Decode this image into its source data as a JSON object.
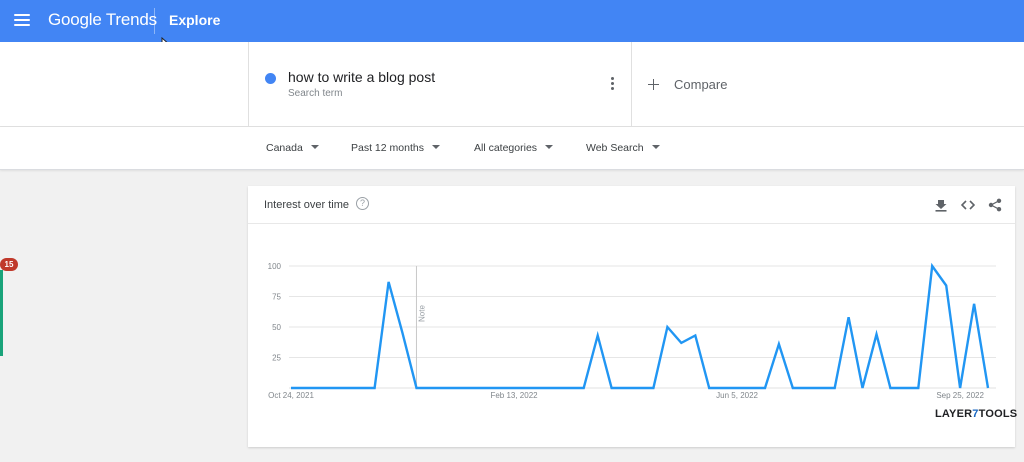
{
  "header": {
    "logo_text": "Google Trends",
    "section_title": "Explore",
    "menu_icon": "hamburger-menu-icon"
  },
  "search_terms": [
    {
      "label": "how to write a blog post",
      "sublabel": "Search term",
      "color": "#4285f4"
    }
  ],
  "compare": {
    "label": "Compare"
  },
  "filters": [
    {
      "label": "Canada"
    },
    {
      "label": "Past 12 months"
    },
    {
      "label": "All categories"
    },
    {
      "label": "Web Search"
    }
  ],
  "notification": {
    "count": "15"
  },
  "card": {
    "title": "Interest over time",
    "icons": [
      "help-icon",
      "download-icon",
      "embed-code-icon",
      "share-icon"
    ]
  },
  "watermark": {
    "part1": "LAYER",
    "part2": "7",
    "part3": "TOOLS"
  },
  "chart_data": {
    "type": "line",
    "ylim": [
      0,
      100
    ],
    "yticks": [
      25,
      50,
      75,
      100
    ],
    "x_tick_labels": [
      {
        "label": "Oct 24, 2021",
        "index": 0
      },
      {
        "label": "Feb 13, 2022",
        "index": 16
      },
      {
        "label": "Jun 5, 2022",
        "index": 32
      },
      {
        "label": "Sep 25, 2022",
        "index": 48
      }
    ],
    "note": {
      "label": "Note",
      "index": 9
    },
    "series": [
      {
        "color": "#2196f3",
        "values": [
          0,
          0,
          0,
          0,
          0,
          0,
          0,
          87,
          45,
          0,
          0,
          0,
          0,
          0,
          0,
          0,
          0,
          0,
          0,
          0,
          0,
          0,
          43,
          0,
          0,
          0,
          0,
          50,
          37,
          43,
          0,
          0,
          0,
          0,
          0,
          36,
          0,
          0,
          0,
          0,
          58,
          0,
          44,
          0,
          0,
          0,
          100,
          84,
          0,
          69,
          0
        ]
      }
    ]
  }
}
